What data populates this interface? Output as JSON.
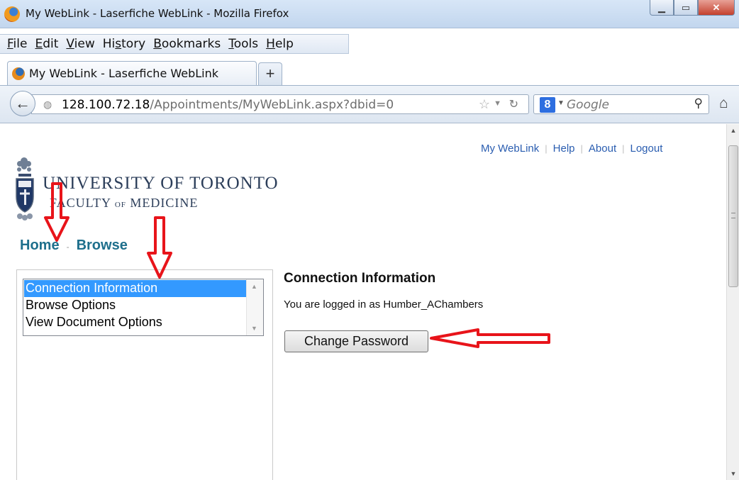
{
  "window": {
    "title": "My WebLink - Laserfiche WebLink - Mozilla Firefox"
  },
  "menubar": {
    "items": [
      {
        "label": "File",
        "accel": "F"
      },
      {
        "label": "Edit",
        "accel": "E"
      },
      {
        "label": "View",
        "accel": "V"
      },
      {
        "label": "History",
        "accel": "s"
      },
      {
        "label": "Bookmarks",
        "accel": "B"
      },
      {
        "label": "Tools",
        "accel": "T"
      },
      {
        "label": "Help",
        "accel": "H"
      }
    ]
  },
  "tabs": {
    "active_label": "My WebLink - Laserfiche WebLink",
    "new_tab_label": "+"
  },
  "navbar": {
    "url_host": "128.100.72.18",
    "url_path": "/Appointments/MyWebLink.aspx?dbid=0",
    "search_placeholder": "Google",
    "search_engine_icon": "google-icon"
  },
  "page": {
    "top_links": [
      "My WebLink",
      "Help",
      "About",
      "Logout"
    ],
    "logo": {
      "university": "UNIVERSITY OF TORONTO",
      "faculty_pre": "FACULTY ",
      "faculty_of": "OF",
      "faculty_post": " MEDICINE"
    },
    "breadcrumb": {
      "home": "Home",
      "separator": "-",
      "browse": "Browse"
    },
    "options_list": {
      "items": [
        "Connection Information",
        "Browse Options",
        "View Document Options"
      ],
      "selected_index": 0
    },
    "content": {
      "title": "Connection Information",
      "logged_in_text": "You are logged in as Humber_AChambers",
      "change_password_label": "Change Password"
    }
  },
  "colors": {
    "link_blue": "#2a5db0",
    "breadcrumb_teal": "#1e6f8c",
    "selection_blue": "#3399ff",
    "annotation_red": "#e8141a"
  }
}
